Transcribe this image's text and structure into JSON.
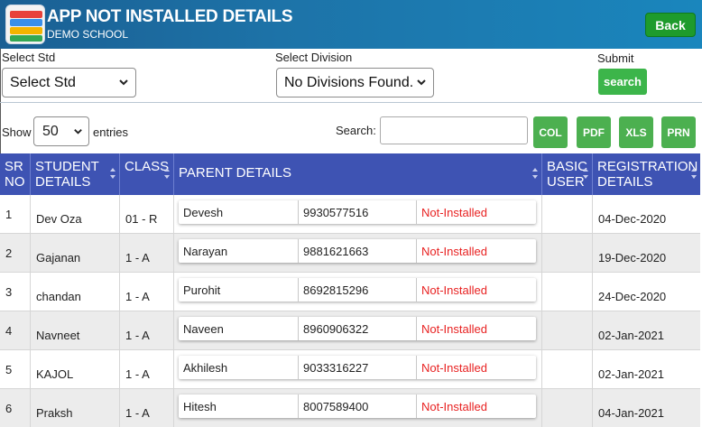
{
  "header": {
    "title": "APP NOT INSTALLED DETAILS",
    "school": "DEMO SCHOOL",
    "back_label": "Back"
  },
  "filters": {
    "std_label": "Select Std",
    "std_value": "Select Std",
    "division_label": "Select Division",
    "division_value": "No Divisions Found.",
    "submit_label": "Submit",
    "search_button": "search"
  },
  "controls": {
    "show_label": "Show",
    "entries_value": "50",
    "entries_label": "entries",
    "search_label": "Search:",
    "search_value": "",
    "export_buttons": [
      "COL",
      "PDF",
      "XLS",
      "PRN"
    ]
  },
  "table": {
    "headers": {
      "sr": "SR NO",
      "student": "STUDENT DETAILS",
      "class": "CLASS",
      "parent": "PARENT DETAILS",
      "basic": "BASIC USER",
      "registration": "REGISTRATION DETAILS"
    },
    "rows": [
      {
        "sr": "1",
        "student": "Dev Oza",
        "class": "01 - R",
        "parent": "Devesh",
        "phone": "9930577516",
        "status": "Not-Installed",
        "basic": "",
        "date": "04-Dec-2020"
      },
      {
        "sr": "2",
        "student": "Gajanan",
        "class": "1 - A",
        "parent": "Narayan",
        "phone": "9881621663",
        "status": "Not-Installed",
        "basic": "",
        "date": "19-Dec-2020"
      },
      {
        "sr": "3",
        "student": "chandan",
        "class": "1 - A",
        "parent": "Purohit",
        "phone": "8692815296",
        "status": "Not-Installed",
        "basic": "",
        "date": "24-Dec-2020"
      },
      {
        "sr": "4",
        "student": "Navneet",
        "class": "1 - A",
        "parent": "Naveen",
        "phone": "8960906322",
        "status": "Not-Installed",
        "basic": "",
        "date": "02-Jan-2021"
      },
      {
        "sr": "5",
        "student": "KAJOL",
        "class": "1 - A",
        "parent": "Akhilesh",
        "phone": "9033316227",
        "status": "Not-Installed",
        "basic": "",
        "date": "02-Jan-2021"
      },
      {
        "sr": "6",
        "student": "Praksh",
        "class": "1 - A",
        "parent": "Hitesh",
        "phone": "8007589400",
        "status": "Not-Installed",
        "basic": "",
        "date": "04-Jan-2021"
      }
    ]
  },
  "colors": {
    "header_bg": "#1d73a8",
    "table_header_bg": "#3e53b3",
    "button_green": "#4cb050",
    "status_red": "#e82222"
  },
  "icons": {
    "logo": "school-logo-icon",
    "dropdown": "chevron-down-icon",
    "sort": "sort-icon"
  }
}
